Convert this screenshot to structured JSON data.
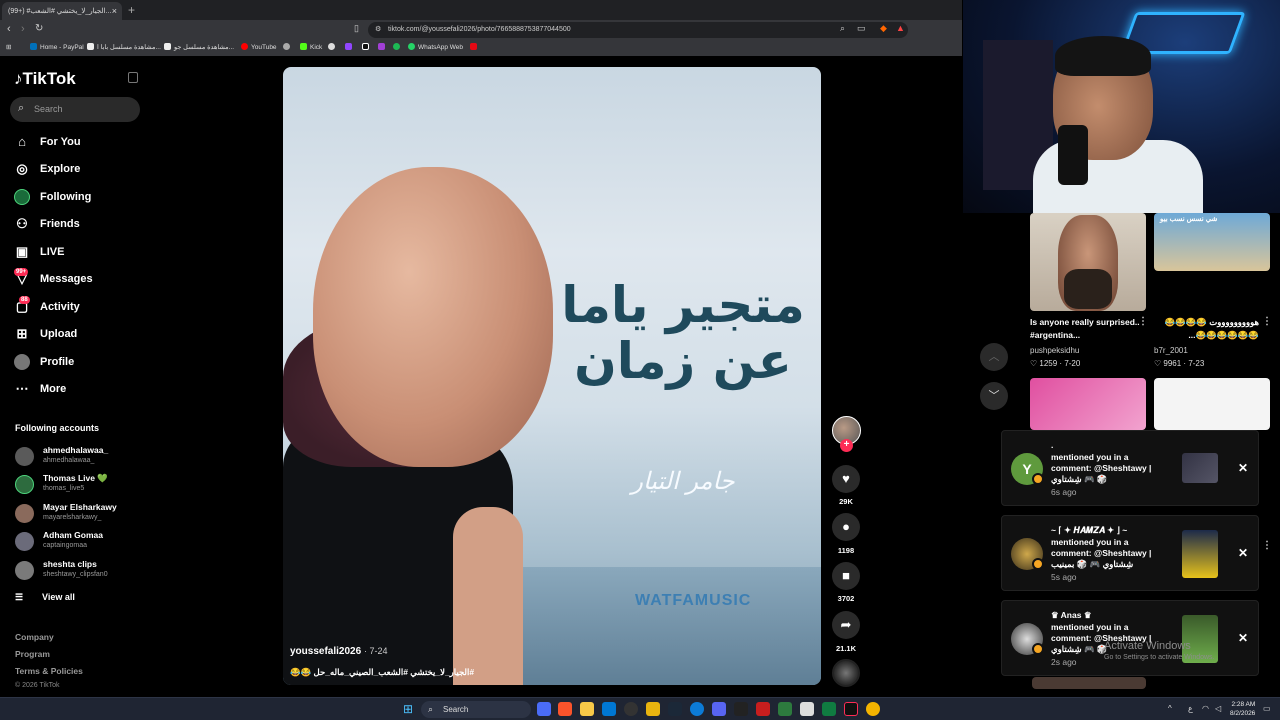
{
  "browser": {
    "tab_title": "(99+) #الجيار_لا_يختشي #الشعب...",
    "tab_close": "×",
    "new_tab": "+",
    "url": "tiktok.com/@youssefali2026/photo/7665888753877044500",
    "bookmarks": [
      "Home - PayPal",
      "مشاهدة مسلسل بابا ا...",
      "مشاهدة مسلسل جو...",
      "YouTube",
      "Kick",
      "WhatsApp Web"
    ]
  },
  "sidebar": {
    "brand": "TikTok",
    "search_placeholder": "Search",
    "nav": [
      {
        "label": "For You"
      },
      {
        "label": "Explore"
      },
      {
        "label": "Following"
      },
      {
        "label": "Friends"
      },
      {
        "label": "LIVE"
      },
      {
        "label": "Messages",
        "badge": "99+"
      },
      {
        "label": "Activity",
        "badge": "88"
      },
      {
        "label": "Upload"
      },
      {
        "label": "Profile"
      },
      {
        "label": "More"
      }
    ],
    "following_title": "Following accounts",
    "accounts": [
      {
        "name": "ahmedhalawaa_",
        "handle": "ahmedhalawaa_"
      },
      {
        "name": "Thomas Live 💚",
        "handle": "thomas_live5"
      },
      {
        "name": "Mayar Elsharkawy",
        "handle": "mayarelsharkawy_"
      },
      {
        "name": "Adham Gomaa",
        "handle": "captaingomaa"
      },
      {
        "name": "sheshta clips",
        "handle": "sheshtawy_clipsfan0"
      }
    ],
    "view_all": "View all",
    "footer_links": [
      "Company",
      "Program",
      "Terms & Policies"
    ],
    "copyright": "© 2026 TikTok"
  },
  "post": {
    "title_line1": "متجير ياما",
    "title_line2": "عن زمان",
    "signature": "جامر التيار",
    "watermark": "WATFAMUSIC",
    "author": "youssefali2026",
    "date": "· 7-24",
    "caption": "#الجيار_لا_يختشي #الشعب_الصيني_ماله_حل 😂😂"
  },
  "actions": {
    "likes": "29K",
    "comments": "1198",
    "saves": "3702",
    "shares": "21.1K"
  },
  "feed": [
    {
      "caption": "Is anyone really surprised.. #argentina...",
      "author": "pushpeksidhu",
      "likes": "1259",
      "date": "7-20"
    },
    {
      "caption": "هوووووووووت 😂😂😂😂 😂😂😂😂😂😂...",
      "author": "b7r_2001",
      "likes": "9961",
      "date": "7-23"
    },
    {
      "caption": "شي نسس نسب بيو",
      "author": "",
      "likes": "",
      "date": ""
    }
  ],
  "notifications": [
    {
      "name": ".",
      "line1": "mentioned you in a",
      "line2": "comment: @Sheshtawy |",
      "line3": "شِشتاوي 🎮 🎲",
      "ago": "6s ago",
      "avatar_letter": "Y"
    },
    {
      "name": "~ ⌈ ✦ 𝑯𝑨𝑴𝒁𝑨 ✦ ⌋ ~",
      "line1": "mentioned you in a",
      "line2": "comment: @Sheshtawy |",
      "line3": "شِشتاوي 🎮 🎲 بمينيب",
      "ago": "5s ago",
      "avatar_letter": ""
    },
    {
      "name": "♛ Anas ♛",
      "line1": "mentioned you in a",
      "line2": "comment: @Sheshtawy |",
      "line3": "شِشتاوي 🎮 🎲",
      "ago": "2s ago",
      "avatar_letter": ""
    }
  ],
  "windows_watermark": {
    "title": "Activate Windows",
    "sub": "Go to Settings to activate Windows."
  },
  "taskbar": {
    "search": "Search",
    "time": "2:28 AM",
    "date": "8/2/2026"
  }
}
